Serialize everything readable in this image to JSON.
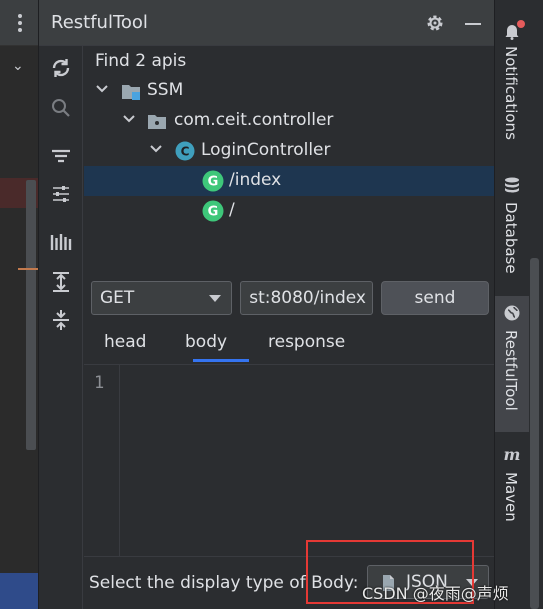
{
  "window": {
    "title": "RestfulTool"
  },
  "tree": {
    "summary": "Find 2 apis",
    "nodes": [
      {
        "label": "SSM",
        "icon": "module-folder-icon"
      },
      {
        "label": "com.ceit.controller",
        "icon": "package-folder-icon"
      },
      {
        "label": "LoginController",
        "icon": "class-icon",
        "icon_letter": "C"
      },
      {
        "label": "/index",
        "icon": "get-method-icon",
        "icon_letter": "G",
        "selected": true
      },
      {
        "label": "/",
        "icon": "get-method-icon",
        "icon_letter": "G"
      }
    ]
  },
  "request": {
    "method": "GET",
    "url": "st:8080/index",
    "send_label": "send"
  },
  "tabs": [
    {
      "label": "head"
    },
    {
      "label": "body",
      "active": true
    },
    {
      "label": "response"
    }
  ],
  "editor": {
    "line_number": "1"
  },
  "bottom": {
    "label": "Select the display type of Body:",
    "type_value": "JSON"
  },
  "right_stripe": [
    {
      "label": "Notifications",
      "icon": "bell-icon"
    },
    {
      "label": "Database",
      "icon": "database-icon"
    },
    {
      "label": "RestfulTool",
      "icon": "globe-icon",
      "active": true
    },
    {
      "label": "Maven",
      "icon": "maven-icon",
      "icon_letter": "m"
    }
  ],
  "watermark": "CSDN @夜雨@声烦",
  "colors": {
    "accent": "#3574f0",
    "selection": "#1e3650",
    "get_badge": "#3ec77a",
    "class_badge": "#3f9fbd",
    "highlight_box": "#e53935"
  }
}
